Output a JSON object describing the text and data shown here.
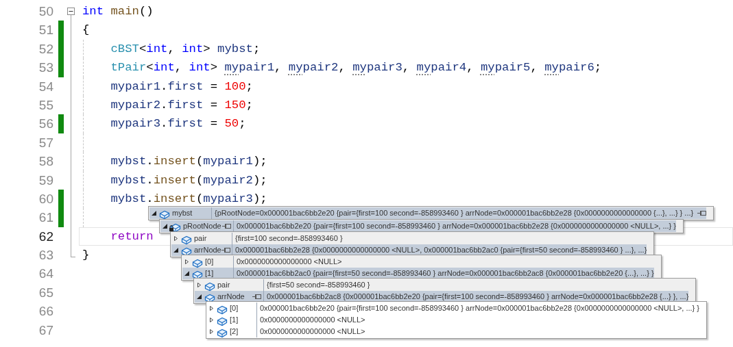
{
  "editor": {
    "lines": [
      {
        "number": "50",
        "current": false,
        "changed": false,
        "expanded": true,
        "tokens": [
          {
            "t": "int ",
            "kind": "keyword"
          },
          {
            "t": "main",
            "kind": "func"
          },
          {
            "t": "()"
          }
        ],
        "children": [
          {
            "number": "51",
            "current": false,
            "changed": true,
            "tokens": [
              {
                "t": "{"
              }
            ]
          },
          {
            "number": "52",
            "current": false,
            "changed": true,
            "guide": true,
            "indented": true,
            "tokens": [
              {
                "t": "cBST",
                "kind": "type"
              },
              {
                "t": "<"
              },
              {
                "t": "int",
                "kind": "keyword"
              },
              {
                "t": ", "
              },
              {
                "t": "int",
                "kind": "keyword"
              },
              {
                "t": "> "
              },
              {
                "t": "mybst",
                "kind": "var"
              },
              {
                "t": ";"
              }
            ]
          },
          {
            "number": "53",
            "current": false,
            "changed": true,
            "guide": true,
            "indented": true,
            "tokens": [
              {
                "t": "tPair",
                "kind": "type"
              },
              {
                "t": "<"
              },
              {
                "t": "int",
                "kind": "keyword"
              },
              {
                "t": ", "
              },
              {
                "t": "int",
                "kind": "keyword"
              },
              {
                "t": "> "
              },
              {
                "t": "my",
                "kind": "var",
                "dots": true
              },
              {
                "t": "pair1",
                "kind": "var"
              },
              {
                "t": ", "
              },
              {
                "t": "my",
                "kind": "var",
                "dots": true
              },
              {
                "t": "pair2",
                "kind": "var"
              },
              {
                "t": ", "
              },
              {
                "t": "my",
                "kind": "var",
                "dots": true
              },
              {
                "t": "pair3",
                "kind": "var"
              },
              {
                "t": ", "
              },
              {
                "t": "my",
                "kind": "var",
                "dots": true
              },
              {
                "t": "pair4",
                "kind": "var"
              },
              {
                "t": ", "
              },
              {
                "t": "my",
                "kind": "var",
                "dots": true
              },
              {
                "t": "pair5",
                "kind": "var"
              },
              {
                "t": ", "
              },
              {
                "t": "my",
                "kind": "var",
                "dots": true
              },
              {
                "t": "pair6",
                "kind": "var"
              },
              {
                "t": ";"
              }
            ]
          },
          {
            "number": "54",
            "current": false,
            "changed": false,
            "guide": true,
            "indented": true,
            "tokens": [
              {
                "t": "mypair1",
                "kind": "var"
              },
              {
                "t": "."
              },
              {
                "t": "first",
                "kind": "var"
              },
              {
                "t": " = "
              },
              {
                "t": "100",
                "kind": "number"
              },
              {
                "t": ";"
              }
            ]
          },
          {
            "number": "55",
            "current": false,
            "changed": false,
            "guide": true,
            "indented": true,
            "tokens": [
              {
                "t": "mypair2",
                "kind": "var"
              },
              {
                "t": "."
              },
              {
                "t": "first",
                "kind": "var"
              },
              {
                "t": " = "
              },
              {
                "t": "150",
                "kind": "number"
              },
              {
                "t": ";"
              }
            ]
          },
          {
            "number": "56",
            "current": false,
            "changed": true,
            "guide": true,
            "indented": true,
            "tokens": [
              {
                "t": "mypair3",
                "kind": "var"
              },
              {
                "t": "."
              },
              {
                "t": "first",
                "kind": "var"
              },
              {
                "t": " = "
              },
              {
                "t": "50",
                "kind": "number"
              },
              {
                "t": ";"
              }
            ]
          },
          {
            "number": "57",
            "current": false,
            "changed": false,
            "guide": true
          },
          {
            "number": "58",
            "current": false,
            "changed": false,
            "guide": true,
            "indented": true,
            "tokens": [
              {
                "t": "mybst",
                "kind": "var"
              },
              {
                "t": "."
              },
              {
                "t": "insert",
                "kind": "func"
              },
              {
                "t": "("
              },
              {
                "t": "mypair1",
                "kind": "var"
              },
              {
                "t": ");"
              }
            ]
          },
          {
            "number": "59",
            "current": false,
            "changed": false,
            "guide": true,
            "indented": true,
            "tokens": [
              {
                "t": "mybst",
                "kind": "var"
              },
              {
                "t": "."
              },
              {
                "t": "insert",
                "kind": "func"
              },
              {
                "t": "("
              },
              {
                "t": "mypair2",
                "kind": "var"
              },
              {
                "t": ");"
              }
            ]
          },
          {
            "number": "60",
            "current": false,
            "changed": true,
            "guide": true,
            "indented": true,
            "tokens": [
              {
                "t": "mybst",
                "kind": "var"
              },
              {
                "t": "."
              },
              {
                "t": "insert",
                "kind": "func"
              },
              {
                "t": "("
              },
              {
                "t": "mypair3",
                "kind": "var"
              },
              {
                "t": ");"
              }
            ]
          },
          {
            "number": "61",
            "current": false,
            "changed": true,
            "guide": true
          },
          {
            "number": "62",
            "current": true,
            "changed": false,
            "indented": true,
            "tokens": [
              {
                "t": "return",
                "kind": "control"
              }
            ]
          },
          {
            "number": "63",
            "current": false,
            "changed": false,
            "tokens": [
              {
                "t": "}"
              }
            ]
          }
        ]
      },
      {
        "number": "64",
        "current": false,
        "changed": false
      },
      {
        "number": "65",
        "current": false,
        "changed": false
      },
      {
        "number": "66",
        "current": false,
        "changed": false
      },
      {
        "number": "67",
        "current": false,
        "changed": false
      }
    ]
  },
  "datatips": [
    {
      "rows": [
        {
          "name": "mybst",
          "expanded": true,
          "pin_at_end": true,
          "value": "{pRootNode=0x000001bac6bb2e20 {pair={first=100 second=-858993460 } arrNode=0x000001bac6bb2e28 {0x0000000000000000 {...}, ...} } ...}"
        }
      ]
    },
    {
      "rows": [
        {
          "name": "pRootNode",
          "expanded": true,
          "locked": true,
          "pin_by_name": true,
          "value": "0x000001bac6bb2e20 {pair={first=100 second=-858993460 } arrNode=0x000001bac6bb2e28 {0x0000000000000000 <NULL>, ...} }"
        }
      ]
    },
    {
      "rows": [
        {
          "name": "pair",
          "expanded": false,
          "value": "{first=100 second=-858993460 }"
        },
        {
          "name": "arrNode",
          "expanded": true,
          "pin_by_name": true,
          "value": "0x000001bac6bb2e28 {0x0000000000000000 <NULL>, 0x000001bac6bb2ac0 {pair={first=50 second=-858993460 } ...}, ...}"
        }
      ]
    },
    {
      "rows": [
        {
          "name": "[0]",
          "expanded": false,
          "value": "0x0000000000000000 <NULL>"
        },
        {
          "name": "[1]",
          "expanded": true,
          "value": "0x000001bac6bb2ac0 {pair={first=50 second=-858993460 } arrNode=0x000001bac6bb2ac8 {0x000001bac6bb2e20 {...}, ...} }"
        }
      ]
    },
    {
      "rows": [
        {
          "name": "pair",
          "expanded": false,
          "value": "{first=50 second=-858993460 }"
        },
        {
          "name": "arrNode",
          "expanded": true,
          "pin_by_name": true,
          "value": "0x000001bac6bb2ac8 {0x000001bac6bb2e20 {pair={first=100 second=-858993460 } arrNode=0x000001bac6bb2e28 {...} }, ...}"
        }
      ]
    },
    {
      "rows": [
        {
          "name": "[0]",
          "expanded": false,
          "value": "0x000001bac6bb2e20 {pair={first=100 second=-858993460 } arrNode=0x000001bac6bb2e28 {0x0000000000000000 <NULL>, ...} }"
        },
        {
          "name": "[1]",
          "expanded": false,
          "value": "0x0000000000000000 <NULL>"
        },
        {
          "name": "[2]",
          "expanded": false,
          "value": "0x0000000000000000 <NULL>"
        }
      ]
    }
  ]
}
